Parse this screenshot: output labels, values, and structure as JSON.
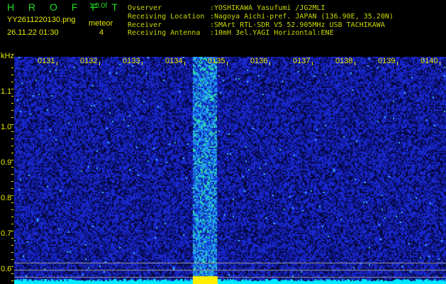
{
  "header": {
    "app_name": "H R O F F T",
    "version": "1.0.0f",
    "filename": "YY2611220130.png",
    "datetime": "26.11.22 01:30",
    "meteor_label": "meteor",
    "meteor_count": "4"
  },
  "info": [
    {
      "label": "Ovserver",
      "value": ":YOSHIKAWA Yasufumi /JG2MLI"
    },
    {
      "label": "Receiving Location",
      "value": ":Nagoya Aichi-pref. JAPAN (136.90E, 35.20N)"
    },
    {
      "label": "Receiver",
      "value": ":SMArt RTL-SDR V5 52.905MHz USB TACHIKAWA"
    },
    {
      "label": "Receiving Antenna",
      "value": ":10mH 3el.YAGI Horizontal:ENE"
    }
  ],
  "chart_data": {
    "type": "heatmap",
    "ylabel": "kHz",
    "x_ticks": [
      "0131",
      "0132",
      "0133",
      "0134",
      "0135",
      "0136",
      "0137",
      "0138",
      "0139",
      "0140"
    ],
    "y_ticks": [
      "1.1",
      "1.0",
      "0.9",
      "0.8",
      "0.7",
      "0.6"
    ],
    "ylim": [
      0.56,
      1.2
    ],
    "reference_lines_khz": [
      0.62,
      0.6,
      0.58
    ],
    "bright_band_time": "0134-0135",
    "colors": {
      "background": "#000000",
      "noise": "#1a2ad0",
      "signal": "#20c0ff",
      "baseline": "#00e8ff",
      "marker": "#ffee00",
      "text": "#e8e800"
    }
  }
}
